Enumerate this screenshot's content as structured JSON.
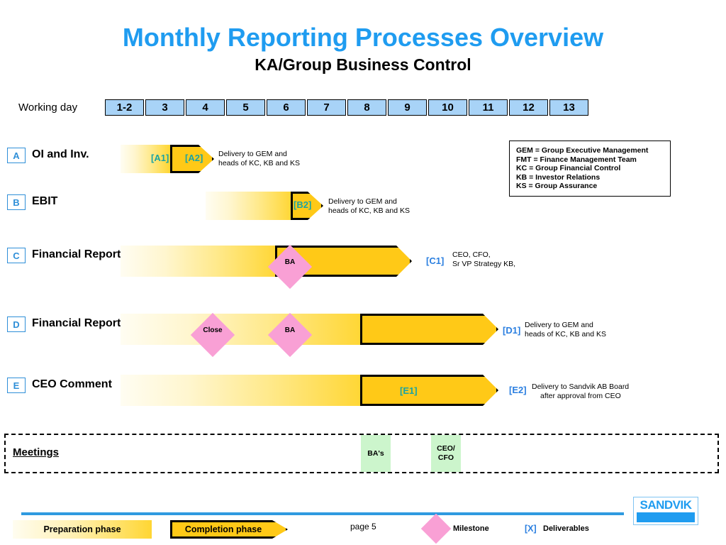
{
  "header": {
    "title": "Monthly Reporting Processes Overview",
    "subtitle": "KA/Group Business Control",
    "title_color": "#1f9cf0"
  },
  "timeline": {
    "axis_label": "Working day",
    "days": [
      "1-2",
      "3",
      "4",
      "5",
      "6",
      "7",
      "8",
      "9",
      "10",
      "11",
      "12",
      "13"
    ]
  },
  "abbreviations": [
    "GEM = Group Executive Management",
    "FMT = Finance Management Team",
    "KC = Group Financial Control",
    "KB = Investor Relations",
    "KS = Group Assurance"
  ],
  "processes": [
    {
      "badge": "A",
      "name": "OI and Inv.",
      "inline_tags": [
        "[A1]",
        "[A2]"
      ],
      "deliverable_tag": "",
      "note": "Delivery to GEM and\nheads of KC, KB and KS",
      "note_line1": "Delivery to GEM and",
      "note_line2": "heads of KC, KB and KS",
      "milestones": []
    },
    {
      "badge": "B",
      "name": "EBIT",
      "inline_tags": [
        "[B2]"
      ],
      "deliverable_tag": "",
      "note_line1": "Delivery to GEM and",
      "note_line2": "heads of KC, KB and KS",
      "milestones": []
    },
    {
      "badge": "C",
      "name": "Financial Report Slim",
      "inline_tags": [],
      "deliverable_tag": "[C1]",
      "note_line1": "CEO, CFO,",
      "note_line2": "Sr VP Strategy KB,",
      "milestones": [
        "BA"
      ]
    },
    {
      "badge": "D",
      "name": "Financial Report",
      "inline_tags": [],
      "deliverable_tag": "[D1]",
      "note_line1": "Delivery to GEM and",
      "note_line2": "heads of KC, KB and KS",
      "milestones": [
        "Close",
        "BA"
      ]
    },
    {
      "badge": "E",
      "name": "CEO Comment",
      "inline_tags": [
        "[E1]"
      ],
      "deliverable_tag": "[E2]",
      "note_line1": "Delivery to Sandvik AB Board",
      "note_line2": "after approval from CEO",
      "milestones": []
    }
  ],
  "meetings": {
    "title": "Meetings",
    "items": [
      {
        "label": "BA's",
        "line1": "BA's",
        "line2": ""
      },
      {
        "label": "CEO/CFO",
        "line1": "CEO/",
        "line2": "CFO"
      }
    ]
  },
  "footer": {
    "preparation_label": "Preparation phase",
    "completion_label": "Completion phase",
    "page": "page 5",
    "milestone_label": "Milestone",
    "deliverables_tag": "[X]",
    "deliverables_label": "Deliverables",
    "logo": "SANDVIK"
  }
}
